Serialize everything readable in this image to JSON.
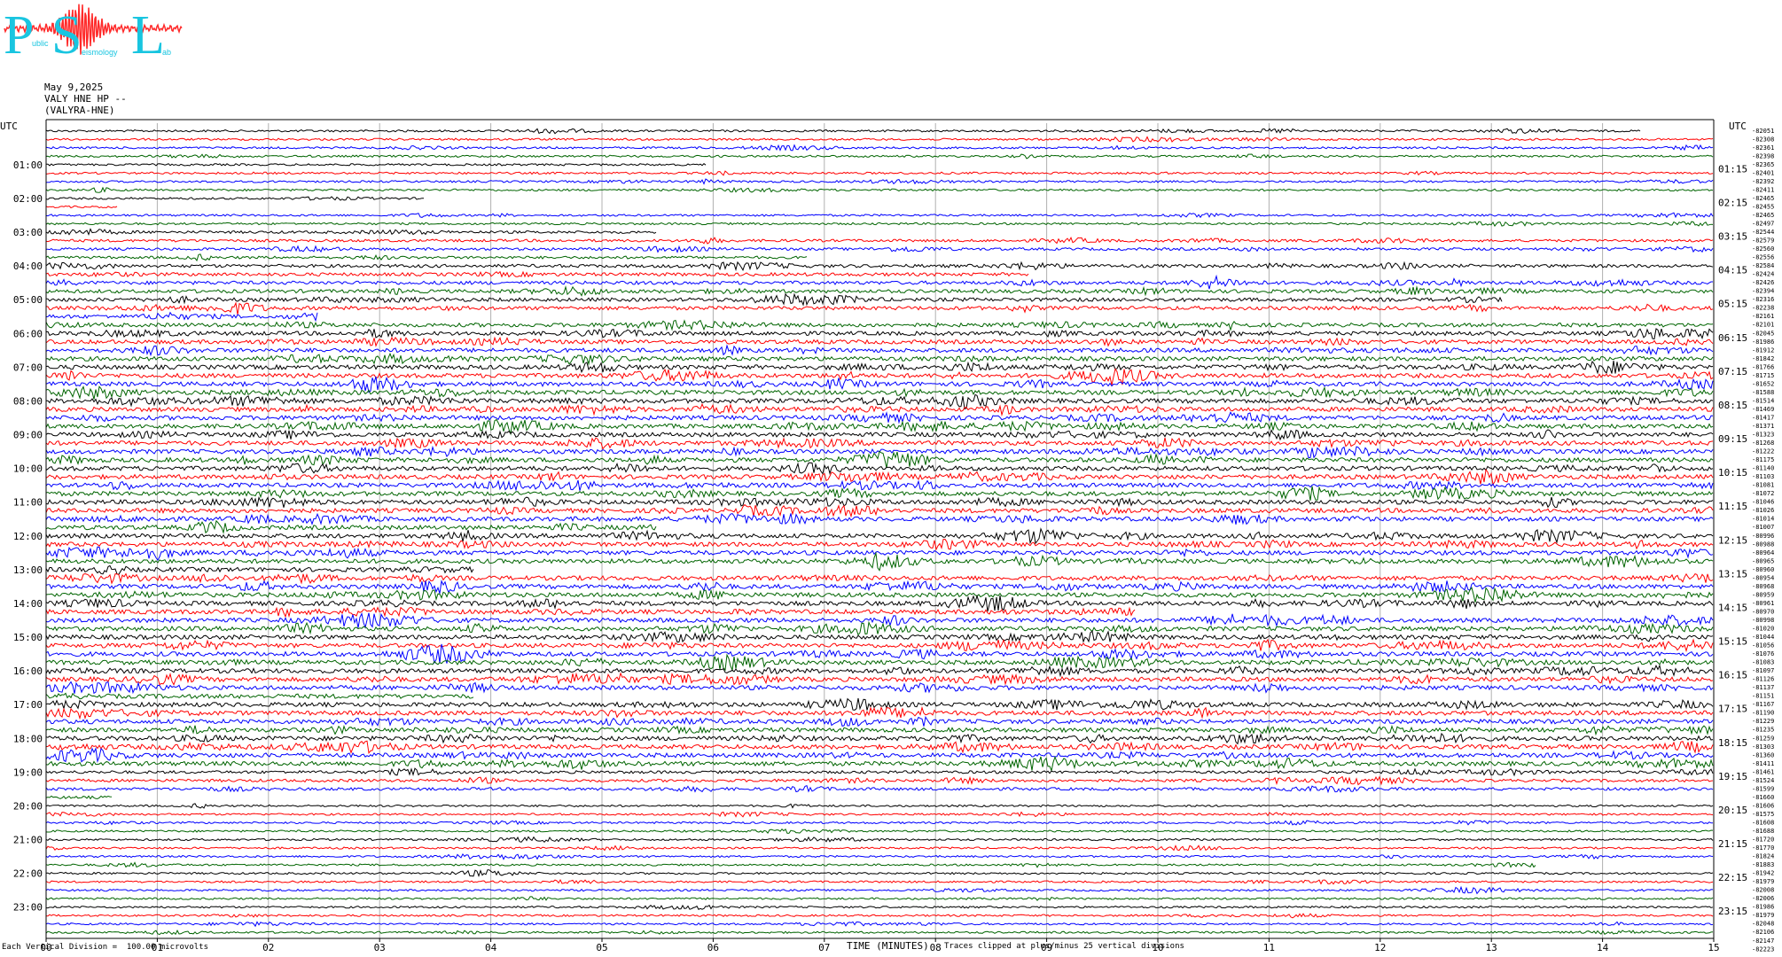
{
  "logo": {
    "letters": [
      "P",
      "S",
      "L"
    ],
    "small_text": [
      "ublic",
      "eismology",
      "ab"
    ]
  },
  "header": {
    "date": "May 9,2025",
    "station": "VALY HNE HP --",
    "channel": "(VALYRA-HNE)"
  },
  "colors": {
    "trace_cycle": [
      "#000000",
      "#ff0000",
      "#0000ff",
      "#006400"
    ],
    "logo_cyan": "#19c5e0",
    "logo_red": "#ff2a2a",
    "grid": "#b0b0b0"
  },
  "chart_data": {
    "type": "seismogram_helicorder",
    "traces_per_hour": 4,
    "total_traces": 96,
    "minutes_per_trace": 15,
    "left_axis_title": "UTC",
    "right_axis_title": "UTC",
    "left_hour_labels": [
      "01:00",
      "02:00",
      "03:00",
      "04:00",
      "05:00",
      "06:00",
      "07:00",
      "08:00",
      "09:00",
      "10:00",
      "11:00",
      "12:00",
      "13:00",
      "14:00",
      "15:00",
      "16:00",
      "17:00",
      "18:00",
      "19:00",
      "20:00",
      "21:00",
      "22:00",
      "23:00"
    ],
    "right_hour_labels": [
      "01:15",
      "02:15",
      "03:15",
      "04:15",
      "05:15",
      "06:15",
      "07:15",
      "08:15",
      "09:15",
      "10:15",
      "11:15",
      "12:15",
      "13:15",
      "14:15",
      "15:15",
      "16:15",
      "17:15",
      "18:15",
      "19:15",
      "20:15",
      "21:15",
      "22:15",
      "23:15"
    ],
    "x_ticks": [
      "00",
      "01",
      "02",
      "03",
      "04",
      "05",
      "06",
      "07",
      "08",
      "09",
      "10",
      "11",
      "12",
      "13",
      "14",
      "15"
    ],
    "xlabel": "TIME (MINUTES)",
    "trace_offsets": [
      "-82051",
      "-82308",
      "-82361",
      "-82398",
      "-82365",
      "-82401",
      "-82392",
      "-82411",
      "-82465",
      "-82455",
      "-82465",
      "-82497",
      "-82544",
      "-82579",
      "-82560",
      "-82556",
      "-82584",
      "-82424",
      "-82426",
      "-82394",
      "-82316",
      "-82238",
      "-82161",
      "-82101",
      "-82045",
      "-81986",
      "-81912",
      "-81842",
      "-81766",
      "-81715",
      "-81652",
      "-81588",
      "-81514",
      "-81469",
      "-81417",
      "-81371",
      "-81323",
      "-81268",
      "-81222",
      "-81175",
      "-81140",
      "-81103",
      "-81081",
      "-81072",
      "-81046",
      "-81026",
      "-81014",
      "-81007",
      "-80996",
      "-80988",
      "-80964",
      "-80965",
      "-80960",
      "-80954",
      "-80968",
      "-80959",
      "-80961",
      "-80970",
      "-80998",
      "-81020",
      "-81044",
      "-81056",
      "-81076",
      "-81083",
      "-81097",
      "-81126",
      "-81137",
      "-81151",
      "-81167",
      "-81190",
      "-81229",
      "-81235",
      "-81259",
      "-81303",
      "-81360",
      "-81411",
      "-81461",
      "-81524",
      "-81599",
      "-81660",
      "-81606",
      "-81575",
      "-81608",
      "-81688",
      "-81720",
      "-81770",
      "-81824",
      "-81883",
      "-81942",
      "-81979",
      "-82008",
      "-82006",
      "-81986",
      "-81979",
      "-82048",
      "-82106",
      "-82147",
      "-82223"
    ],
    "events": [
      {
        "trace": 0,
        "minute": 14.45,
        "amp": 3.2
      },
      {
        "trace": 4,
        "minute": 6.05,
        "amp": 3.0
      },
      {
        "trace": 8,
        "minute": 3.5,
        "amp": 4.5
      },
      {
        "trace": 9,
        "minute": 0.75,
        "amp": 2.2
      },
      {
        "trace": 12,
        "minute": 5.6,
        "amp": 1.6
      },
      {
        "trace": 12,
        "minute": 7.1,
        "amp": 2.5
      },
      {
        "trace": 15,
        "minute": 6.95,
        "amp": 4.2
      },
      {
        "trace": 15,
        "minute": 11.5,
        "amp": 2.4
      },
      {
        "trace": 17,
        "minute": 8.95,
        "amp": 2.2
      },
      {
        "trace": 20,
        "minute": 13.2,
        "amp": 2.6
      },
      {
        "trace": 22,
        "minute": 2.55,
        "amp": 1.8
      },
      {
        "trace": 47,
        "minute": 5.6,
        "amp": 1.8
      },
      {
        "trace": 52,
        "minute": 3.95,
        "amp": 4.0
      },
      {
        "trace": 52,
        "minute": 6.6,
        "amp": 2.0
      },
      {
        "trace": 57,
        "minute": 9.9,
        "amp": 2.2
      },
      {
        "trace": 67,
        "minute": 3.95,
        "amp": 2.4
      },
      {
        "trace": 79,
        "minute": 0.7,
        "amp": 2.0
      },
      {
        "trace": 79,
        "minute": 14.9,
        "amp": 2.4
      },
      {
        "trace": 87,
        "minute": 13.5,
        "amp": 3.2
      }
    ]
  },
  "footer": {
    "left_note": "Each Vertical Division =  100.00 microvolts",
    "center_label": "TIME (MINUTES)",
    "clip_note": "Traces clipped at plus/minus 25 vertical divisions"
  }
}
